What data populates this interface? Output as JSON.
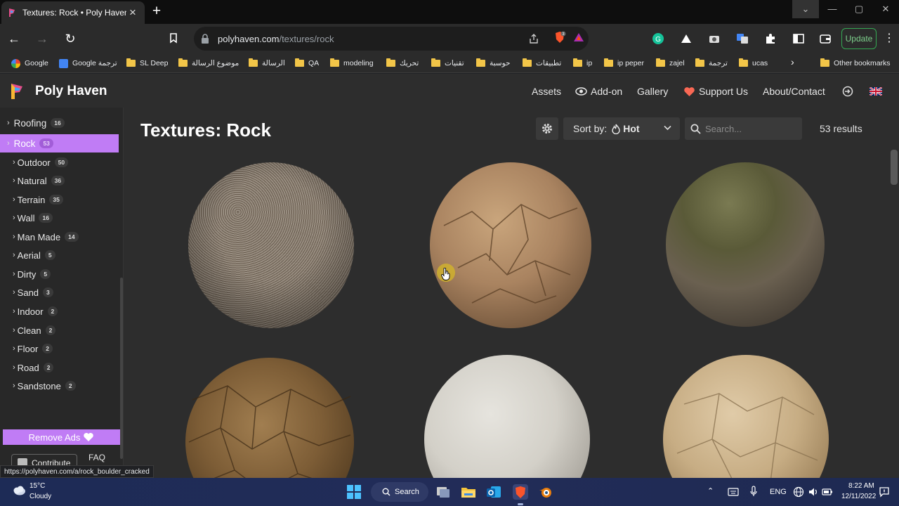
{
  "browser": {
    "tab_title": "Textures: Rock • Poly Haven",
    "url_host": "polyhaven.com",
    "url_path": "/textures/rock",
    "update_label": "Update",
    "brave_shield_count": "3",
    "status_url": "https://polyhaven.com/a/rock_boulder_cracked"
  },
  "bookmarks": [
    {
      "label": "Google",
      "icon": "google-icon"
    },
    {
      "label": "Google ترجمة",
      "icon": "translate-icon"
    },
    {
      "label": "SL Deep",
      "icon": "folder-icon"
    },
    {
      "label": "موضوع الرسالة",
      "icon": "folder-icon"
    },
    {
      "label": "الرسالة",
      "icon": "folder-icon"
    },
    {
      "label": "QA",
      "icon": "folder-icon"
    },
    {
      "label": "modeling",
      "icon": "folder-icon"
    },
    {
      "label": "تحريك",
      "icon": "folder-icon"
    },
    {
      "label": "تقنيات",
      "icon": "folder-icon"
    },
    {
      "label": "حوسبة",
      "icon": "folder-icon"
    },
    {
      "label": "تطبيقات",
      "icon": "folder-icon"
    },
    {
      "label": "ip",
      "icon": "folder-icon"
    },
    {
      "label": "ip peper",
      "icon": "folder-icon"
    },
    {
      "label": "zajel",
      "icon": "folder-icon"
    },
    {
      "label": "ترجمة",
      "icon": "folder-icon"
    },
    {
      "label": "ucas",
      "icon": "folder-icon"
    },
    {
      "label": "Other bookmarks",
      "icon": "folder-icon"
    }
  ],
  "site": {
    "brand": "Poly Haven",
    "nav": {
      "assets": "Assets",
      "addon": "Add-on",
      "gallery": "Gallery",
      "support": "Support Us",
      "about": "About/Contact"
    }
  },
  "sidebar": {
    "roofing": {
      "label": "Roofing",
      "count": "16"
    },
    "rock": {
      "label": "Rock",
      "count": "53"
    },
    "subcategories": [
      {
        "label": "Outdoor",
        "count": "50"
      },
      {
        "label": "Natural",
        "count": "36"
      },
      {
        "label": "Terrain",
        "count": "35"
      },
      {
        "label": "Wall",
        "count": "16"
      },
      {
        "label": "Man Made",
        "count": "14"
      },
      {
        "label": "Aerial",
        "count": "5"
      },
      {
        "label": "Dirty",
        "count": "5"
      },
      {
        "label": "Sand",
        "count": "3"
      },
      {
        "label": "Indoor",
        "count": "2"
      },
      {
        "label": "Clean",
        "count": "2"
      },
      {
        "label": "Floor",
        "count": "2"
      },
      {
        "label": "Road",
        "count": "2"
      },
      {
        "label": "Sandstone",
        "count": "2"
      }
    ],
    "remove_ads": "Remove Ads",
    "contribute": "Contribute",
    "faq": "FAQ"
  },
  "main": {
    "title": "Textures: Rock",
    "sort_label": "Sort by:",
    "sort_value": "Hot",
    "search_placeholder": "Search...",
    "results": "53 results"
  },
  "taskbar": {
    "temperature": "15°C",
    "condition": "Cloudy",
    "search_label": "Search",
    "language": "ENG",
    "time": "8:22 AM",
    "date": "12/11/2022"
  }
}
